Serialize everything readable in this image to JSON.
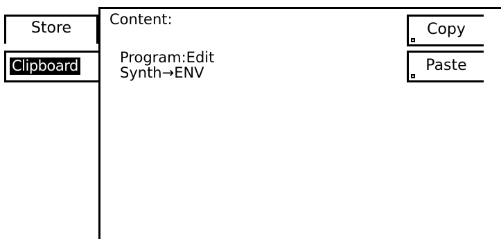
{
  "tabs": {
    "store_label": "Store",
    "clipboard_label": "Clipboard"
  },
  "content": {
    "title": "Content:",
    "lines": [
      "Program:Edit",
      "Synth→ENV"
    ]
  },
  "buttons": {
    "copy_label": "Copy",
    "paste_label": "Paste"
  }
}
